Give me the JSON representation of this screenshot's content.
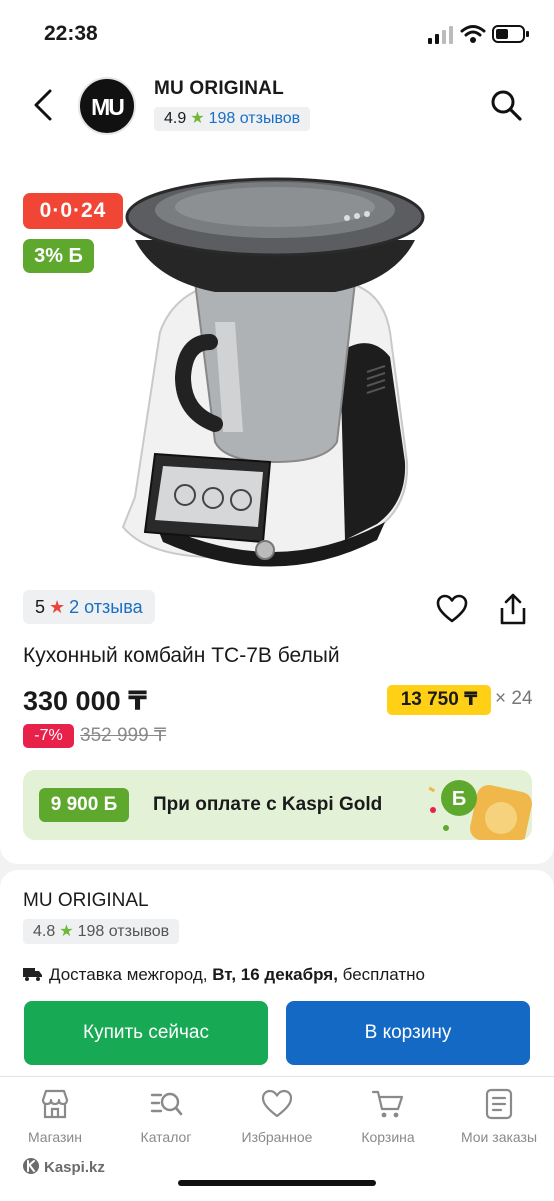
{
  "status_bar": {
    "time": "22:38"
  },
  "header": {
    "shop_name": "MU ORIGINAL",
    "logo_text": "MU",
    "rating": "4.9",
    "reviews": "198 отзывов"
  },
  "product": {
    "timer_badge": "0·0·24",
    "bonus_badge": "3% Б",
    "rating": "5",
    "reviews": "2 отзыва",
    "title": "Кухонный комбайн TC-7B белый",
    "price": "330 000 ₸",
    "installment_amount": "13 750 ₸",
    "installment_months": "× 24",
    "discount": "-7%",
    "old_price": "352 999 ₸"
  },
  "kaspi_gold": {
    "amount": "9 900 Б",
    "text": "При оплате с Kaspi Gold"
  },
  "seller": {
    "name": "MU ORIGINAL",
    "rating": "4.8",
    "reviews": "198 отзывов",
    "delivery_prefix": "Доставка межгород, ",
    "delivery_date": "Вт, 16 декабря,",
    "delivery_suffix": " бесплатно"
  },
  "actions": {
    "buy_now": "Купить сейчас",
    "add_to_cart": "В корзину"
  },
  "tabs": [
    {
      "label": "Магазин",
      "icon": "store-icon"
    },
    {
      "label": "Каталог",
      "icon": "catalog-search-icon"
    },
    {
      "label": "Избранное",
      "icon": "heart-icon"
    },
    {
      "label": "Корзина",
      "icon": "cart-icon"
    },
    {
      "label": "Мои заказы",
      "icon": "orders-icon"
    }
  ],
  "footer_brand": "Kaspi.kz",
  "colors": {
    "timer_red": "#f14635",
    "bonus_green": "#5ea82e",
    "installment_yellow": "#ffd015",
    "buy_green": "#17a954",
    "cart_blue": "#1469c4",
    "link_blue": "#1a6fc4"
  }
}
